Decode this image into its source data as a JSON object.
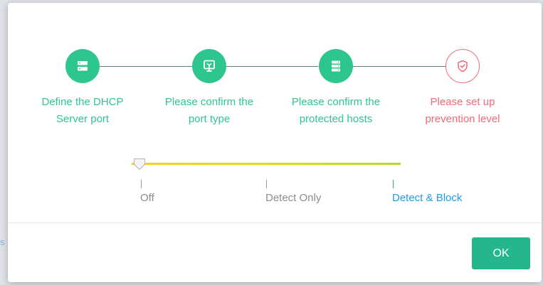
{
  "steps": [
    {
      "line1": "Define the DHCP",
      "line2": "Server port",
      "icon": "server-icon",
      "state": "done"
    },
    {
      "line1": "Please confirm the",
      "line2": "port type",
      "icon": "port-icon",
      "state": "done"
    },
    {
      "line1": "Please confirm the",
      "line2": "protected hosts",
      "icon": "hosts-icon",
      "state": "done"
    },
    {
      "line1": "Please set up",
      "line2": "prevention level",
      "icon": "shield-check-icon",
      "state": "current"
    }
  ],
  "prevention": {
    "levels": [
      "Off",
      "Detect Only",
      "Detect & Block"
    ],
    "selected": "Detect & Block"
  },
  "footer": {
    "ok_label": "OK"
  },
  "colors": {
    "step_done": "#2ec68f",
    "step_current": "#f06a78",
    "level_active": "#1a9ee8",
    "ok_button": "#24b68c"
  }
}
